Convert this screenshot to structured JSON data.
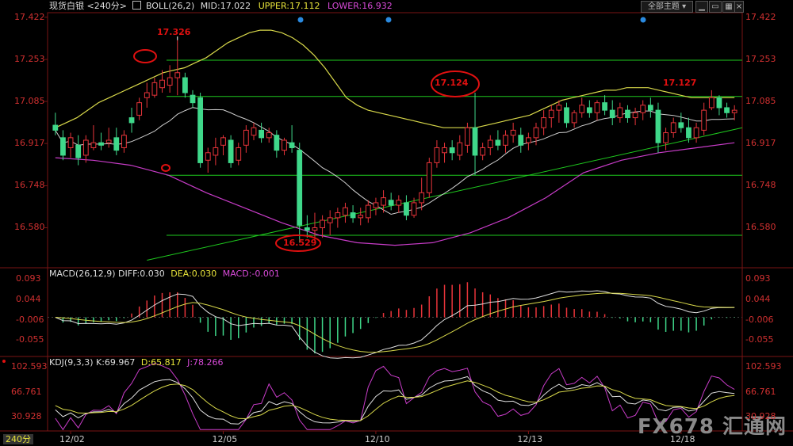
{
  "header": {
    "symbol": "现货白银",
    "period": "<240分>",
    "boll": "BOLL(26,2)",
    "mid": "MID:17.022",
    "upper": "UPPER:17.112",
    "lower": "LOWER:16.932",
    "theme_button": "全部主题",
    "period_tag": "240分"
  },
  "colors": {
    "up": "#e8343a",
    "down": "#3fd88a",
    "upper": "#d8d84a",
    "mid": "#cfcfcf",
    "lower": "#c83cc8",
    "support": "#1ec81e",
    "highlight": "#e01010",
    "axis": "#d03030"
  },
  "watermark": "FX678 汇通网",
  "chart_data": [
    {
      "type": "candlestick",
      "title": "现货白银 240分 BOLL(26,2)",
      "ylim": [
        16.42,
        17.44
      ],
      "y_ticks": [
        "17.422",
        "17.253",
        "17.085",
        "16.917",
        "16.748",
        "16.580"
      ],
      "x_ticks": [
        "12/02",
        "12/05",
        "12/10",
        "12/13",
        "12/18"
      ],
      "x_tick_index": [
        2,
        22,
        42,
        62,
        82
      ],
      "candles": [
        [
          16.99,
          17.04,
          16.95,
          16.97
        ],
        [
          16.94,
          16.97,
          16.85,
          16.87
        ],
        [
          16.9,
          16.96,
          16.86,
          16.94
        ],
        [
          16.91,
          16.95,
          16.83,
          16.86
        ],
        [
          16.87,
          16.95,
          16.84,
          16.93
        ],
        [
          16.9,
          16.99,
          16.89,
          16.92
        ],
        [
          16.92,
          16.96,
          16.89,
          16.91
        ],
        [
          16.92,
          16.98,
          16.9,
          16.93
        ],
        [
          16.94,
          16.98,
          16.87,
          16.89
        ],
        [
          16.9,
          16.97,
          16.88,
          16.95
        ],
        [
          17.02,
          17.06,
          16.96,
          17.0
        ],
        [
          17.03,
          17.1,
          17.01,
          17.08
        ],
        [
          17.1,
          17.16,
          17.06,
          17.12
        ],
        [
          17.11,
          17.18,
          17.1,
          17.16
        ],
        [
          17.14,
          17.21,
          17.12,
          17.17
        ],
        [
          17.15,
          17.23,
          17.12,
          17.18
        ],
        [
          17.18,
          17.33,
          17.11,
          17.2
        ],
        [
          17.18,
          17.2,
          17.1,
          17.12
        ],
        [
          17.11,
          17.13,
          17.06,
          17.08
        ],
        [
          17.1,
          17.12,
          16.82,
          16.84
        ],
        [
          16.85,
          16.9,
          16.8,
          16.88
        ],
        [
          16.87,
          16.94,
          16.83,
          16.9
        ],
        [
          16.91,
          16.95,
          16.87,
          16.94
        ],
        [
          16.93,
          16.95,
          16.82,
          16.84
        ],
        [
          16.85,
          16.92,
          16.83,
          16.9
        ],
        [
          16.91,
          16.99,
          16.88,
          16.97
        ],
        [
          16.95,
          17.0,
          16.93,
          16.98
        ],
        [
          16.97,
          17.0,
          16.92,
          16.94
        ],
        [
          16.94,
          16.98,
          16.92,
          16.96
        ],
        [
          16.95,
          16.97,
          16.86,
          16.89
        ],
        [
          16.89,
          16.94,
          16.87,
          16.93
        ],
        [
          16.92,
          16.99,
          16.88,
          16.9
        ],
        [
          16.89,
          16.92,
          16.52,
          16.59
        ],
        [
          16.58,
          16.63,
          16.54,
          16.57
        ],
        [
          16.57,
          16.64,
          16.53,
          16.58
        ],
        [
          16.58,
          16.63,
          16.54,
          16.61
        ],
        [
          16.6,
          16.65,
          16.55,
          16.62
        ],
        [
          16.62,
          16.66,
          16.58,
          16.64
        ],
        [
          16.63,
          16.68,
          16.6,
          16.66
        ],
        [
          16.64,
          16.67,
          16.6,
          16.62
        ],
        [
          16.62,
          16.66,
          16.59,
          16.63
        ],
        [
          16.62,
          16.69,
          16.6,
          16.67
        ],
        [
          16.66,
          16.7,
          16.63,
          16.68
        ],
        [
          16.67,
          16.73,
          16.64,
          16.7
        ],
        [
          16.69,
          16.72,
          16.65,
          16.67
        ],
        [
          16.67,
          16.71,
          16.64,
          16.69
        ],
        [
          16.68,
          16.71,
          16.61,
          16.63
        ],
        [
          16.63,
          16.7,
          16.62,
          16.68
        ],
        [
          16.68,
          16.78,
          16.65,
          16.72
        ],
        [
          16.72,
          16.86,
          16.7,
          16.84
        ],
        [
          16.84,
          16.93,
          16.82,
          16.9
        ],
        [
          16.88,
          16.92,
          16.84,
          16.9
        ],
        [
          16.9,
          16.93,
          16.85,
          16.88
        ],
        [
          16.87,
          16.95,
          16.85,
          16.92
        ],
        [
          16.91,
          17.0,
          16.88,
          16.98
        ],
        [
          16.98,
          17.12,
          16.79,
          16.87
        ],
        [
          16.87,
          16.92,
          16.85,
          16.9
        ],
        [
          16.9,
          16.95,
          16.87,
          16.93
        ],
        [
          16.93,
          16.97,
          16.89,
          16.91
        ],
        [
          16.91,
          16.97,
          16.88,
          16.95
        ],
        [
          16.95,
          17.0,
          16.92,
          16.97
        ],
        [
          16.95,
          16.98,
          16.88,
          16.91
        ],
        [
          16.92,
          16.96,
          16.89,
          16.94
        ],
        [
          16.94,
          17.0,
          16.91,
          16.98
        ],
        [
          16.98,
          17.05,
          16.95,
          17.02
        ],
        [
          17.02,
          17.07,
          16.98,
          17.05
        ],
        [
          17.05,
          17.09,
          17.0,
          17.07
        ],
        [
          17.06,
          17.08,
          16.98,
          17.0
        ],
        [
          17.0,
          17.05,
          16.98,
          17.04
        ],
        [
          17.04,
          17.1,
          17.02,
          17.07
        ],
        [
          17.06,
          17.09,
          17.02,
          17.04
        ],
        [
          17.04,
          17.09,
          17.01,
          17.08
        ],
        [
          17.08,
          17.11,
          17.03,
          17.05
        ],
        [
          17.05,
          17.09,
          16.99,
          17.02
        ],
        [
          17.02,
          17.08,
          17.0,
          17.06
        ],
        [
          17.05,
          17.07,
          17.0,
          17.02
        ],
        [
          17.02,
          17.06,
          16.99,
          17.04
        ],
        [
          17.04,
          17.09,
          17.01,
          17.07
        ],
        [
          17.07,
          17.1,
          17.02,
          17.05
        ],
        [
          17.05,
          17.08,
          16.88,
          16.92
        ],
        [
          16.92,
          16.98,
          16.89,
          16.96
        ],
        [
          16.96,
          17.02,
          16.94,
          17.0
        ],
        [
          17.0,
          17.04,
          16.96,
          16.98
        ],
        [
          16.98,
          17.02,
          16.92,
          16.94
        ],
        [
          16.94,
          17.0,
          16.92,
          16.98
        ],
        [
          16.97,
          17.08,
          16.95,
          17.05
        ],
        [
          17.06,
          17.13,
          17.05,
          17.1
        ],
        [
          17.1,
          17.11,
          17.03,
          17.06
        ],
        [
          17.06,
          17.08,
          17.02,
          17.04
        ],
        [
          17.04,
          17.07,
          17.01,
          17.05
        ]
      ],
      "upper": [
        16.98,
        17.0,
        17.02,
        17.05,
        17.08,
        17.1,
        17.12,
        17.14,
        17.16,
        17.18,
        17.2,
        17.21,
        17.22,
        17.24,
        17.26,
        17.29,
        17.32,
        17.34,
        17.36,
        17.37,
        17.37,
        17.36,
        17.34,
        17.31,
        17.27,
        17.22,
        17.16,
        17.1,
        17.07,
        17.05,
        17.04,
        17.03,
        17.02,
        17.01,
        17.0,
        16.99,
        16.98,
        16.98,
        16.98,
        16.98,
        16.99,
        17.0,
        17.01,
        17.02,
        17.03,
        17.05,
        17.07,
        17.09,
        17.1,
        17.11,
        17.12,
        17.13,
        17.13,
        17.14,
        17.14,
        17.14,
        17.13,
        17.12,
        17.11,
        17.1,
        17.1,
        17.1,
        17.1,
        17.1
      ],
      "upper_start": 16,
      "mid_y": [
        16.94,
        16.95,
        16.97,
        16.98,
        17.0,
        17.01,
        17.02,
        17.03,
        17.03,
        17.03
      ],
      "lower_y": [
        16.86,
        16.85,
        16.83,
        16.79,
        16.72,
        16.66,
        16.6,
        16.55,
        16.52,
        16.51,
        16.52,
        16.56,
        16.62,
        16.7,
        16.8,
        16.85,
        16.88,
        16.9,
        16.92
      ]
    },
    {
      "type": "bar",
      "title": "MACD(26,12,9)",
      "diff": "DIFF:0.030",
      "dea": "DEA:0.030",
      "macd": "MACD:-0.001",
      "y_ticks": [
        "0.093",
        "0.044",
        "-0.006",
        "-0.055"
      ],
      "ylim": [
        -0.095,
        0.12
      ]
    },
    {
      "type": "line",
      "title": "KDJ(9,3,3)",
      "k": "K:69.967",
      "d": "D:65.817",
      "j": "J:78.266",
      "y_ticks": [
        "102.593",
        "66.761",
        "30.928"
      ],
      "ylim": [
        10,
        118
      ]
    }
  ],
  "annotations": {
    "high": "17.326",
    "mid_high": "17.124",
    "recent_high": "17.127",
    "low": "16.529"
  }
}
